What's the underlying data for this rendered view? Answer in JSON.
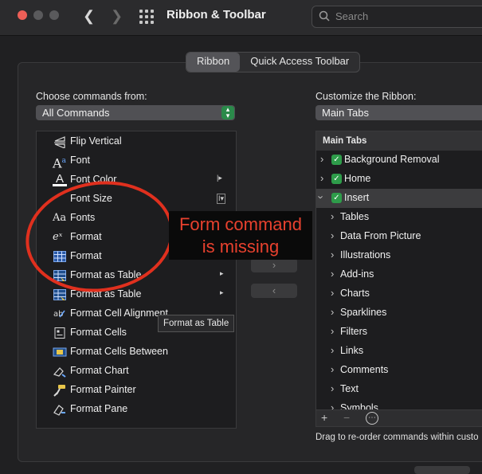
{
  "window": {
    "title": "Ribbon & Toolbar",
    "search_placeholder": "Search"
  },
  "tabs": [
    {
      "label": "Ribbon",
      "active": true
    },
    {
      "label": "Quick Access Toolbar",
      "active": false
    }
  ],
  "left": {
    "label": "Choose commands from:",
    "dropdown_value": "All Commands",
    "commands": [
      {
        "icon": "flip-vertical-icon",
        "label": "Flip Vertical",
        "submenu": ""
      },
      {
        "icon": "font-icon",
        "label": "Font",
        "submenu": ""
      },
      {
        "icon": "font-color-icon",
        "label": "Font Color",
        "submenu": "|▸"
      },
      {
        "icon": "",
        "label": "Font Size",
        "submenu": "I▾"
      },
      {
        "icon": "fonts-icon",
        "label": "Fonts",
        "submenu": ""
      },
      {
        "icon": "equation-format-icon",
        "label": "Format",
        "submenu": ""
      },
      {
        "icon": "table-format-icon",
        "label": "Format",
        "submenu": ""
      },
      {
        "icon": "format-as-table-icon",
        "label": "Format as Table",
        "submenu": "▸"
      },
      {
        "icon": "format-as-table-icon",
        "label": "Format as Table",
        "submenu": "▸"
      },
      {
        "icon": "cell-alignment-icon",
        "label": "Format Cell Alignment",
        "submenu": ""
      },
      {
        "icon": "format-cells-icon",
        "label": "Format Cells",
        "submenu": ""
      },
      {
        "icon": "cells-between-icon",
        "label": "Format Cells Between",
        "submenu": ""
      },
      {
        "icon": "format-chart-icon",
        "label": "Format Chart",
        "submenu": ""
      },
      {
        "icon": "format-painter-icon",
        "label": "Format Painter",
        "submenu": ""
      },
      {
        "icon": "format-pane-icon",
        "label": "Format Pane",
        "submenu": ""
      }
    ],
    "tooltip": "Format as Table"
  },
  "move_buttons": {
    "add": "›",
    "remove": "‹"
  },
  "right": {
    "label": "Customize the Ribbon:",
    "dropdown_value": "Main Tabs",
    "tree_header": "Main Tabs",
    "tree": [
      {
        "label": "Background Removal",
        "level": 0,
        "checked": true,
        "expanded": false
      },
      {
        "label": "Home",
        "level": 0,
        "checked": true,
        "expanded": false
      },
      {
        "label": "Insert",
        "level": 0,
        "checked": true,
        "expanded": true
      },
      {
        "label": "Tables",
        "level": 1
      },
      {
        "label": "Data From Picture",
        "level": 1
      },
      {
        "label": "Illustrations",
        "level": 1
      },
      {
        "label": "Add-ins",
        "level": 1
      },
      {
        "label": "Charts",
        "level": 1
      },
      {
        "label": "Sparklines",
        "level": 1
      },
      {
        "label": "Filters",
        "level": 1
      },
      {
        "label": "Links",
        "level": 1
      },
      {
        "label": "Comments",
        "level": 1
      },
      {
        "label": "Text",
        "level": 1
      },
      {
        "label": "Symbols",
        "level": 1
      }
    ],
    "toolbar": {
      "add": "+",
      "remove": "−",
      "more": "⋯"
    },
    "footnote": "Drag to re-order commands within custo"
  },
  "annotation": {
    "line1": "Form command",
    "line2": "is missing",
    "color": "#e8412e"
  },
  "colors": {
    "accent_green": "#2e9c4a",
    "annotation_red": "#e0301e"
  }
}
